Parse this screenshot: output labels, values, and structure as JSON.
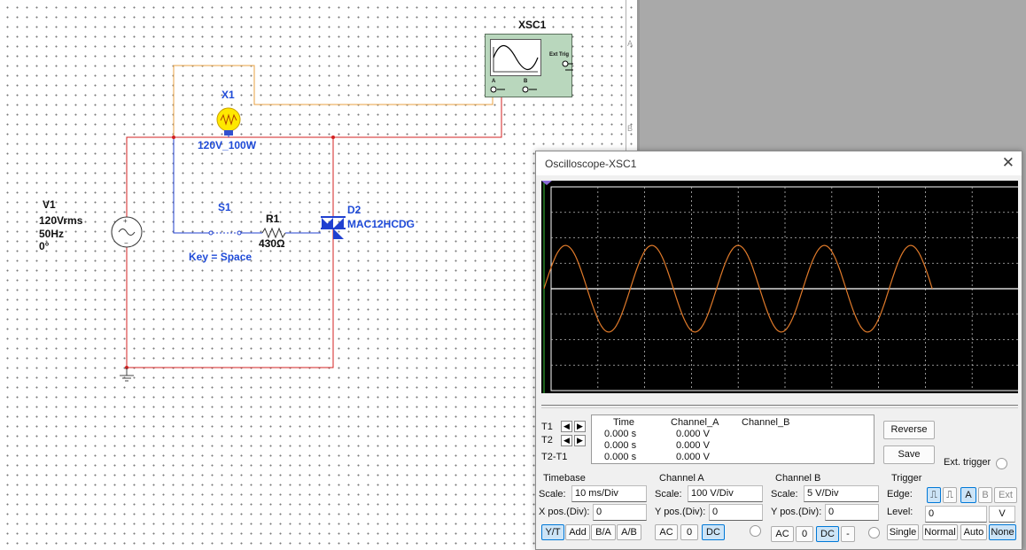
{
  "schematic": {
    "scope_ref": "XSC1",
    "scope_ext_trig": "Ext Trig",
    "scope_pin_a": "A",
    "scope_pin_b": "B",
    "lamp_ref": "X1",
    "lamp_value": "120V_100W",
    "source_ref": "V1",
    "source_voltage": "120Vrms",
    "source_freq": "50Hz",
    "source_phase": "0°",
    "switch_ref": "S1",
    "switch_key": "Key = Space",
    "resistor_ref": "R1",
    "resistor_value": "430Ω",
    "diode_ref": "D2",
    "diode_part": "MAC12HCDG",
    "border_letters": [
      "A",
      "B"
    ]
  },
  "oscilloscope": {
    "title": "Oscilloscope-XSC1",
    "close_icon": "close-icon",
    "readout": {
      "headers": [
        "Time",
        "Channel_A",
        "Channel_B"
      ],
      "rows": [
        {
          "label": "T1",
          "time": "0.000 s",
          "a": "0.000 V"
        },
        {
          "label": "T2",
          "time": "0.000 s",
          "a": "0.000 V"
        },
        {
          "label": "T2-T1",
          "time": "0.000 s",
          "a": "0.000 V"
        }
      ]
    },
    "reverse_label": "Reverse",
    "save_label": "Save",
    "ext_trigger_label": "Ext. trigger",
    "timebase": {
      "title": "Timebase",
      "scale_label": "Scale:",
      "scale_value": "10 ms/Div",
      "xpos_label": "X pos.(Div):",
      "xpos_value": "0",
      "buttons": [
        "Y/T",
        "Add",
        "B/A",
        "A/B"
      ]
    },
    "channel_a": {
      "title": "Channel A",
      "scale_label": "Scale:",
      "scale_value": "100  V/Div",
      "ypos_label": "Y pos.(Div):",
      "ypos_value": "0",
      "buttons": [
        "AC",
        "0",
        "DC"
      ]
    },
    "channel_b": {
      "title": "Channel B",
      "scale_label": "Scale:",
      "scale_value": "5  V/Div",
      "ypos_label": "Y pos.(Div):",
      "ypos_value": "0",
      "buttons": [
        "AC",
        "0",
        "DC",
        "-"
      ]
    },
    "trigger": {
      "title": "Trigger",
      "edge_label": "Edge:",
      "edge_buttons": [
        "A",
        "B",
        "Ext"
      ],
      "level_label": "Level:",
      "level_value": "0",
      "level_unit": "V",
      "mode_buttons": [
        "Single",
        "Normal",
        "Auto",
        "None"
      ]
    },
    "trace_color": "#e07a2a",
    "trace_cycles_shown": 4.5,
    "trace_amplitude_div": 1.7
  }
}
